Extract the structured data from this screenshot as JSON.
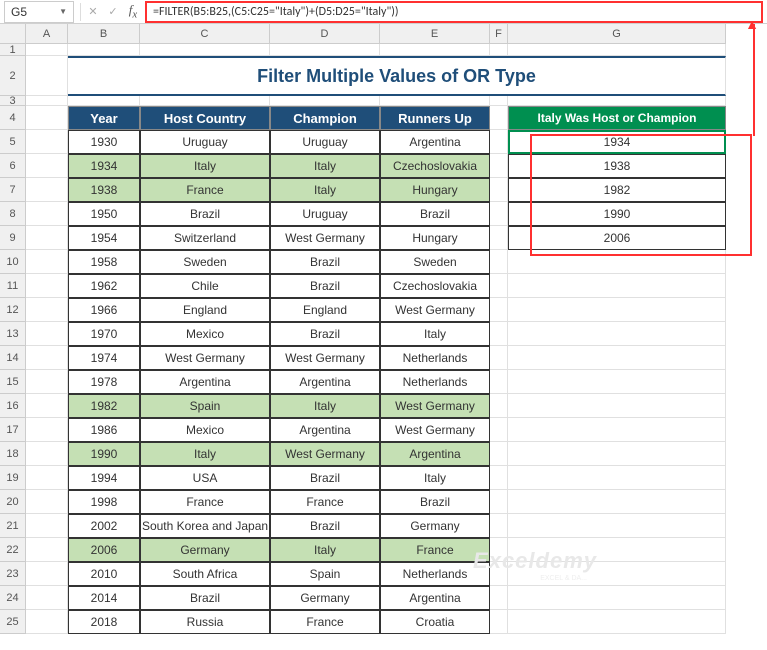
{
  "nameBox": "G5",
  "formula": "=FILTER(B5:B25,(C5:C25=\"Italy\")+(D5:D25=\"Italy\"))",
  "title": "Filter Multiple Values of OR Type",
  "columns": [
    "A",
    "B",
    "C",
    "D",
    "E",
    "F",
    "G"
  ],
  "rows": [
    "1",
    "2",
    "3",
    "4",
    "5",
    "6",
    "7",
    "8",
    "9",
    "10",
    "11",
    "12",
    "13",
    "14",
    "15",
    "16",
    "17",
    "18",
    "19",
    "20",
    "21",
    "22",
    "23",
    "24",
    "25"
  ],
  "headers": {
    "year": "Year",
    "host": "Host Country",
    "champion": "Champion",
    "runners": "Runners Up"
  },
  "greenHeader": "Italy Was Host or Champion",
  "data": [
    {
      "year": "1930",
      "host": "Uruguay",
      "champion": "Uruguay",
      "runners": "Argentina",
      "hl": false
    },
    {
      "year": "1934",
      "host": "Italy",
      "champion": "Italy",
      "runners": "Czechoslovakia",
      "hl": true
    },
    {
      "year": "1938",
      "host": "France",
      "champion": "Italy",
      "runners": "Hungary",
      "hl": true
    },
    {
      "year": "1950",
      "host": "Brazil",
      "champion": "Uruguay",
      "runners": "Brazil",
      "hl": false
    },
    {
      "year": "1954",
      "host": "Switzerland",
      "champion": "West Germany",
      "runners": "Hungary",
      "hl": false
    },
    {
      "year": "1958",
      "host": "Sweden",
      "champion": "Brazil",
      "runners": "Sweden",
      "hl": false
    },
    {
      "year": "1962",
      "host": "Chile",
      "champion": "Brazil",
      "runners": "Czechoslovakia",
      "hl": false
    },
    {
      "year": "1966",
      "host": "England",
      "champion": "England",
      "runners": "West Germany",
      "hl": false
    },
    {
      "year": "1970",
      "host": "Mexico",
      "champion": "Brazil",
      "runners": "Italy",
      "hl": false
    },
    {
      "year": "1974",
      "host": "West Germany",
      "champion": "West Germany",
      "runners": "Netherlands",
      "hl": false
    },
    {
      "year": "1978",
      "host": "Argentina",
      "champion": "Argentina",
      "runners": "Netherlands",
      "hl": false
    },
    {
      "year": "1982",
      "host": "Spain",
      "champion": "Italy",
      "runners": "West Germany",
      "hl": true
    },
    {
      "year": "1986",
      "host": "Mexico",
      "champion": "Argentina",
      "runners": "West Germany",
      "hl": false
    },
    {
      "year": "1990",
      "host": "Italy",
      "champion": "West Germany",
      "runners": "Argentina",
      "hl": true
    },
    {
      "year": "1994",
      "host": "USA",
      "champion": "Brazil",
      "runners": "Italy",
      "hl": false
    },
    {
      "year": "1998",
      "host": "France",
      "champion": "France",
      "runners": "Brazil",
      "hl": false
    },
    {
      "year": "2002",
      "host": "South Korea and Japan",
      "champion": "Brazil",
      "runners": "Germany",
      "hl": false
    },
    {
      "year": "2006",
      "host": "Germany",
      "champion": "Italy",
      "runners": "France",
      "hl": true
    },
    {
      "year": "2010",
      "host": "South Africa",
      "champion": "Spain",
      "runners": "Netherlands",
      "hl": false
    },
    {
      "year": "2014",
      "host": "Brazil",
      "champion": "Germany",
      "runners": "Argentina",
      "hl": false
    },
    {
      "year": "2018",
      "host": "Russia",
      "champion": "France",
      "runners": "Croatia",
      "hl": false
    }
  ],
  "filterResults": [
    "1934",
    "1938",
    "1982",
    "1990",
    "2006"
  ],
  "watermark": "Exceldemy",
  "watermarkSub": "EXCEL & DA..."
}
